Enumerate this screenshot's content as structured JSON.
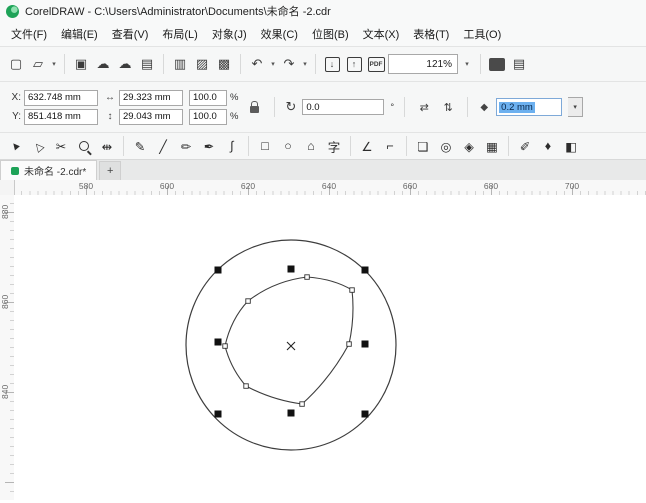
{
  "window": {
    "title": "CorelDRAW - C:\\Users\\Administrator\\Documents\\未命名 -2.cdr"
  },
  "menu": {
    "items": [
      {
        "label": "文件(F)"
      },
      {
        "label": "编辑(E)"
      },
      {
        "label": "查看(V)"
      },
      {
        "label": "布局(L)"
      },
      {
        "label": "对象(J)"
      },
      {
        "label": "效果(C)"
      },
      {
        "label": "位图(B)"
      },
      {
        "label": "文本(X)"
      },
      {
        "label": "表格(T)"
      },
      {
        "label": "工具(O)"
      }
    ]
  },
  "standard_toolbar": {
    "zoom_level": "121%",
    "icons": {
      "new": "▢",
      "open": "▱",
      "save": "▣",
      "cloud_upload": "☁",
      "cloud_download": "☁",
      "print": "▤",
      "paste": "▥",
      "copy": "▨",
      "duplicate": "▩",
      "undo": "↶",
      "redo": "↷",
      "caret": "▾",
      "import": "↓",
      "export": "↑",
      "pdf": "PDF",
      "options": "▤"
    }
  },
  "property_bar": {
    "x_label": "X:",
    "y_label": "Y:",
    "x_value": "632.748 mm",
    "y_value": "851.418 mm",
    "width_icon": "↔",
    "height_icon": "↕",
    "width_value": "29.323 mm",
    "height_value": "29.043 mm",
    "scale_h": "100.0",
    "scale_v": "100.0",
    "percent": "%",
    "rotation_icon": "↻",
    "rotation_value": "0.0",
    "degree_label": "°",
    "mirror_h_icon": "⇄",
    "mirror_v_icon": "⇅",
    "outline_icon": "◆",
    "outline_width": "0.2 mm",
    "caret": "▾"
  },
  "toolbox": {
    "tools": [
      {
        "name": "pick-tool",
        "glyph": "▲"
      },
      {
        "name": "shape-tool",
        "glyph": "△"
      },
      {
        "name": "crop-tool",
        "glyph": "✂"
      },
      {
        "name": "zoom-tool",
        "glyph": ""
      },
      {
        "name": "pan-tool",
        "glyph": "⇹"
      },
      {
        "name": "freehand-tool",
        "glyph": "✎"
      },
      {
        "name": "two-point-line-tool",
        "glyph": "╱"
      },
      {
        "name": "artistic-media-tool",
        "glyph": "✏"
      },
      {
        "name": "pen-tool",
        "glyph": "✒"
      },
      {
        "name": "bezier-tool",
        "glyph": "∫"
      },
      {
        "name": "rectangle-tool",
        "glyph": "□"
      },
      {
        "name": "ellipse-tool",
        "glyph": "○"
      },
      {
        "name": "polygon-tool",
        "glyph": "⌂"
      },
      {
        "name": "text-tool",
        "glyph": "字"
      },
      {
        "name": "dimension-tool",
        "glyph": "∠"
      },
      {
        "name": "connector-tool",
        "glyph": "⌐"
      },
      {
        "name": "drop-shadow-tool",
        "glyph": "❏"
      },
      {
        "name": "contour-tool",
        "glyph": "◎"
      },
      {
        "name": "blend-tool",
        "glyph": "◈"
      },
      {
        "name": "transparency-tool",
        "glyph": "▦"
      },
      {
        "name": "eyedropper-tool",
        "glyph": "✐"
      },
      {
        "name": "outline-pen-tool",
        "glyph": "♦"
      },
      {
        "name": "interactive-fill-tool",
        "glyph": "◧"
      }
    ]
  },
  "document": {
    "tab_label": "未命名 -2.cdr*",
    "new_tab_label": "+"
  },
  "rulers": {
    "horizontal": [
      "580",
      "600",
      "620",
      "640",
      "660",
      "680",
      "700"
    ],
    "vertical": [
      "880",
      "860",
      "840"
    ]
  }
}
